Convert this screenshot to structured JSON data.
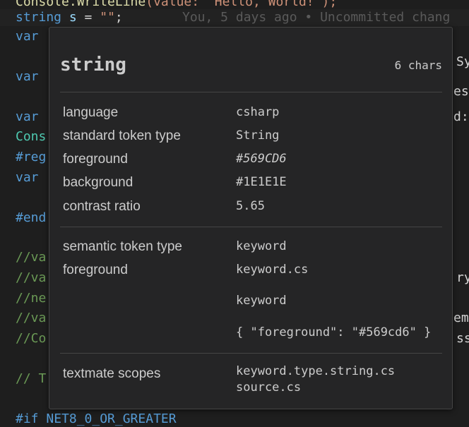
{
  "editor": {
    "lines": {
      "l0": {
        "fn": "Console.WriteLine",
        "arg": "(value: \"Hello, World!\");"
      },
      "l1": {
        "kw": "string",
        "var": "s",
        "rest": " = ",
        "str": "\"\"",
        "end": ";"
      },
      "l2": "var",
      "l3": "var",
      "l4": "var",
      "l5": "Cons",
      "l6": "#reg",
      "l7": "var",
      "l8": "#end",
      "l9": "//va",
      "l10": "//va",
      "l11": "//ne",
      "l12": "//va",
      "l13": "//Co",
      "l14": "// T",
      "l15": {
        "prep": "#if",
        "rest": " NET8_0_OR_GREATER"
      }
    },
    "blame": "You, 5 days ago • Uncommitted chang",
    "right_fragments": {
      "f1": "Sy",
      "f2": "es",
      "f3": "d:",
      "f4": "ry",
      "f5": "emb",
      "f6": "ss"
    }
  },
  "hover": {
    "title": "string",
    "chars": "6 chars",
    "section1": [
      {
        "label": "language",
        "value": "csharp"
      },
      {
        "label": "standard token type",
        "value": "String"
      },
      {
        "label": "foreground",
        "value": "#569CD6"
      },
      {
        "label": "background",
        "value": "#1E1E1E"
      },
      {
        "label": "contrast ratio",
        "value": "5.65"
      }
    ],
    "section2": {
      "semantic_label": "semantic token type",
      "semantic_value": "keyword",
      "fg_label": "foreground",
      "fg_value1": "keyword.cs",
      "fg_value2": "keyword",
      "fg_value3": "{ \"foreground\": \"#569cd6\" }"
    },
    "section3": {
      "label": "textmate scopes",
      "value1": "keyword.type.string.cs",
      "value2": "source.cs"
    }
  },
  "colors": {
    "keyword": "#569cd6",
    "variable": "#9cdcfe",
    "string": "#ce9178",
    "class": "#4ec9b0",
    "comment": "#6a9955",
    "background": "#1e1e1e"
  }
}
